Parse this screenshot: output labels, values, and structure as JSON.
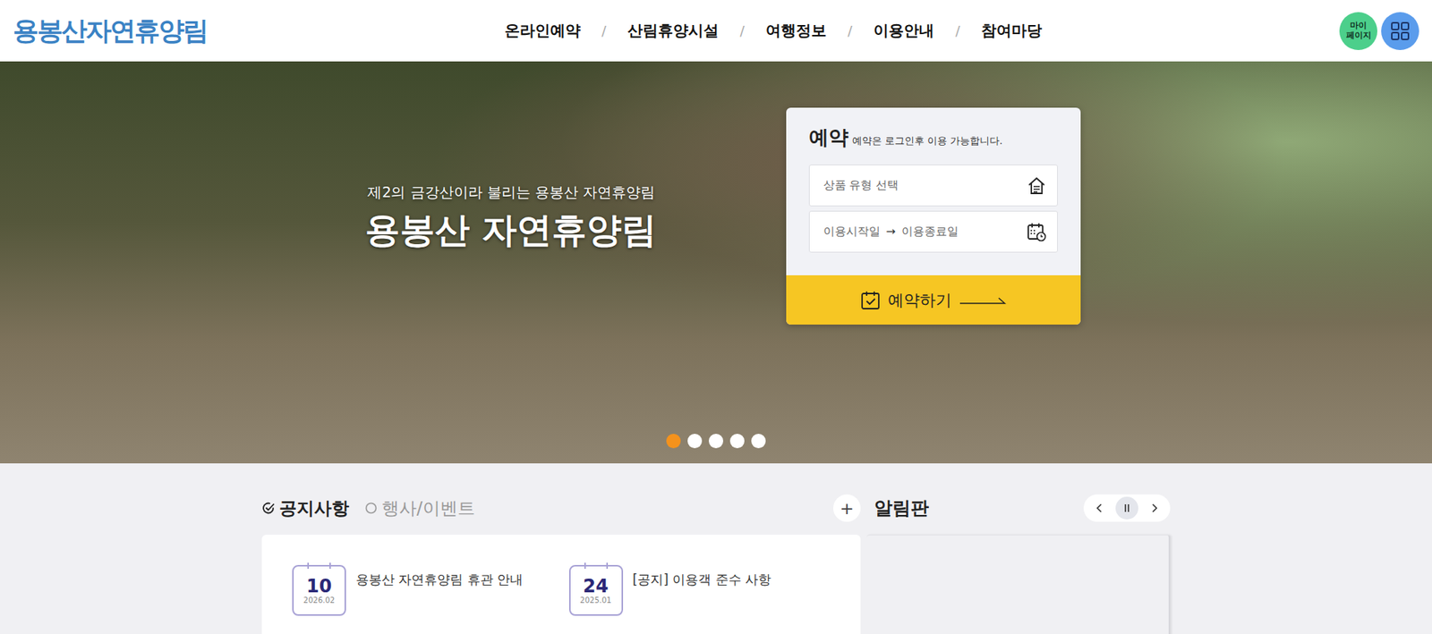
{
  "header": {
    "logo": "용봉산자연휴양림",
    "nav": [
      "온라인예약",
      "산림휴양시설",
      "여행정보",
      "이용안내",
      "참여마당"
    ],
    "separator": "/",
    "mypage_lines": [
      "마이",
      "페이지"
    ]
  },
  "hero": {
    "subtitle": "제2의 금강산이라 불리는 용봉산 자연휴양림",
    "title": "용봉산 자연휴양림",
    "slides": [
      {
        "selected": true
      },
      {
        "selected": false
      },
      {
        "selected": false
      },
      {
        "selected": false
      },
      {
        "selected": false
      }
    ]
  },
  "booking": {
    "title": "예약",
    "note": "예약은 로그인후 이용 가능합니다.",
    "product_placeholder": "상품 유형 선택",
    "date_start": "이용시작일",
    "date_arrow": "→",
    "date_end": "이용종료일",
    "button": "예약하기"
  },
  "notices": {
    "tabs": [
      {
        "label": "공지사항",
        "selected": true
      },
      {
        "label": "행사/이벤트",
        "selected": false
      }
    ],
    "more": "+",
    "items": [
      {
        "day": "10",
        "month": "2026.02",
        "title": "용봉산 자연휴양림 휴관 안내"
      },
      {
        "day": "24",
        "month": "2025.01",
        "title": "[공지] 이용객 준수 사항"
      }
    ]
  },
  "board": {
    "title": "알림판"
  }
}
